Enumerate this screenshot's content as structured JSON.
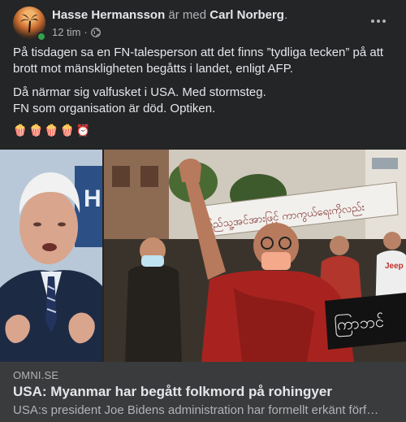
{
  "post": {
    "author": "Hasse Hermansson",
    "with_text": "är med",
    "tagged": "Carl Norberg",
    "period": ".",
    "time": "12 tim",
    "separator": "·",
    "privacy_icon": "globe-icon",
    "paragraphs": [
      "På tisdagen sa en FN-talesperson att det finns ”tydliga tecken” på att brott mot mänskligheten begåtts i landet, enligt AFP.",
      "Då närmar sig valfusket i USA. Med stormsteg.",
      "FN som organisation är död. Optiken."
    ],
    "emojis": [
      "🍿",
      "🍿",
      "🍿",
      "🍿",
      "⏰"
    ]
  },
  "link_preview": {
    "domain": "OMNI.SE",
    "title": "USA: Myanmar har begått folkmord på rohingyer",
    "description": "USA:s president Joe Bidens administration har formellt erkänt förf…"
  },
  "images": {
    "left_sign_text": "H",
    "right_banner_text": "ပြည်သူ့အင်အားဖြင့် ကာကွယ်ရေးကိုလည်း",
    "right_sign_text": "ကြာဘင်",
    "right_shirt_text": "Jeep"
  },
  "colors": {
    "background": "#242526",
    "primary_text": "#e4e6eb",
    "secondary_text": "#b0b3b8",
    "preview_bg": "#3a3b3c",
    "online": "#31a24c"
  }
}
